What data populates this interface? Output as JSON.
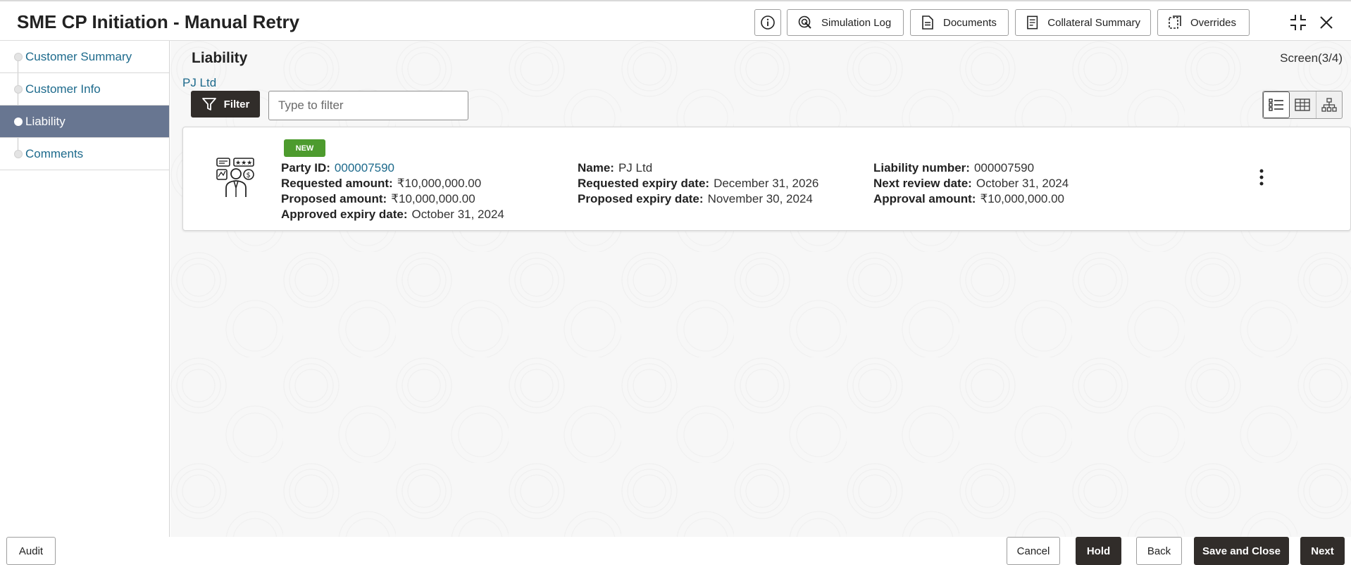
{
  "header": {
    "title": "SME CP Initiation - Manual Retry",
    "buttons": {
      "info_icon": "info-circle-icon",
      "simulation_log": "Simulation Log",
      "documents": "Documents",
      "collateral_summary": "Collateral Summary",
      "overrides": "Overrides"
    },
    "window_icons": [
      "collapse-icon",
      "close-icon"
    ]
  },
  "sidebar": {
    "items": [
      {
        "label": "Customer Summary",
        "active": false
      },
      {
        "label": "Customer Info",
        "active": false
      },
      {
        "label": "Liability",
        "active": true
      },
      {
        "label": "Comments",
        "active": false
      }
    ]
  },
  "main": {
    "section_title": "Liability",
    "screen_count": "Screen(3/4)",
    "breadcrumb": "PJ Ltd",
    "filter_label": "Filter",
    "filter_placeholder": "Type to filter",
    "view_modes": [
      "list-view-icon",
      "table-view-icon",
      "hierarchy-view-icon"
    ],
    "card": {
      "badge": "NEW",
      "col1": [
        {
          "label": "Party ID:",
          "value": "000007590",
          "link": true
        },
        {
          "label": "Requested amount:",
          "value": "₹10,000,000.00"
        },
        {
          "label": "Proposed amount:",
          "value": "₹10,000,000.00"
        },
        {
          "label": "Approved expiry date:",
          "value": "October 31, 2024"
        }
      ],
      "col2": [
        {
          "label": "Name:",
          "value": "PJ Ltd"
        },
        {
          "label": "Requested expiry date:",
          "value": "December 31, 2026"
        },
        {
          "label": "Proposed expiry date:",
          "value": "November 30, 2024"
        }
      ],
      "col3": [
        {
          "label": "Liability number:",
          "value": "000007590"
        },
        {
          "label": "Next review date:",
          "value": "October 31, 2024"
        },
        {
          "label": "Approval amount:",
          "value": "₹10,000,000.00"
        }
      ]
    }
  },
  "footer": {
    "audit": "Audit",
    "cancel": "Cancel",
    "hold": "Hold",
    "back": "Back",
    "save_close": "Save and Close",
    "next": "Next"
  },
  "colors": {
    "active_nav": "#687691",
    "link": "#1d6a8c",
    "badge_new": "#4d9b2e",
    "primary_button": "#312d2a"
  }
}
